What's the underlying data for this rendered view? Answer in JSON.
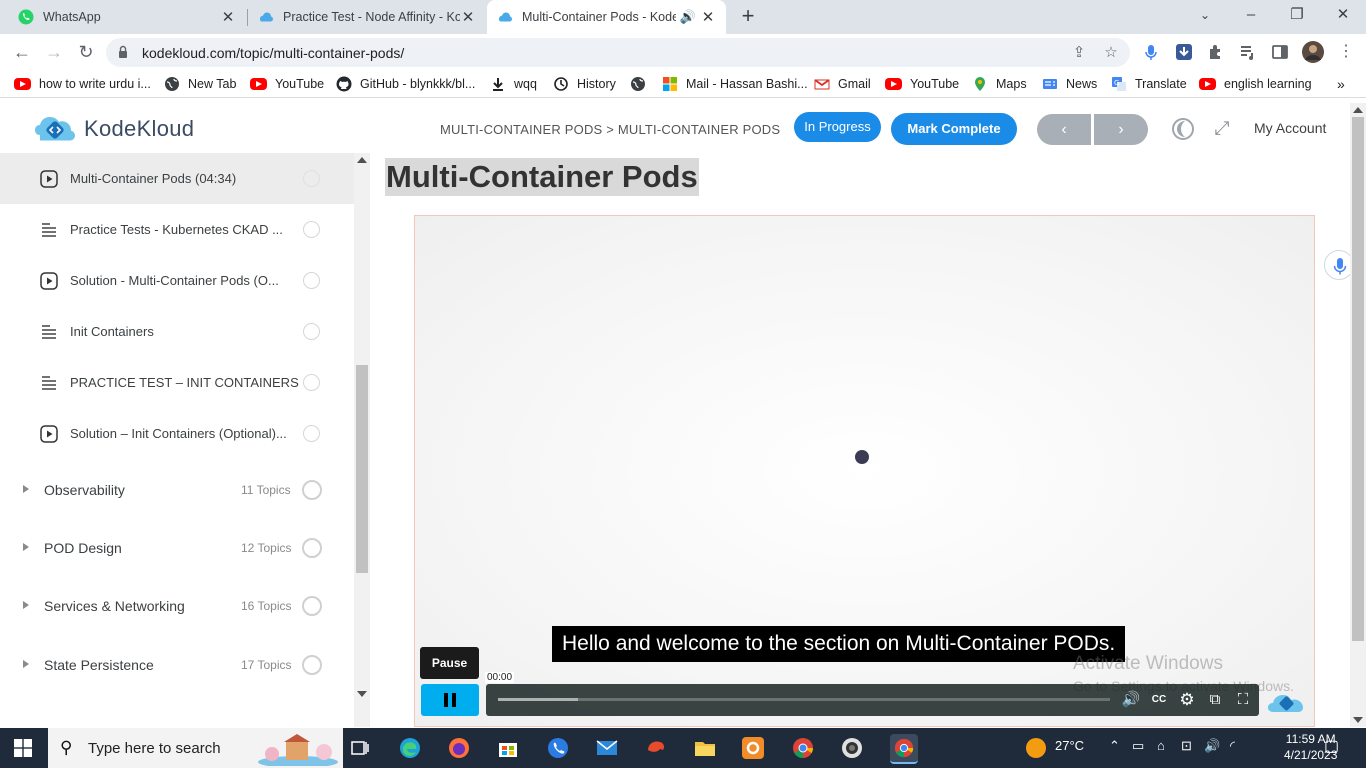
{
  "browser": {
    "tabs": [
      {
        "title": "WhatsApp",
        "active": false
      },
      {
        "title": "Practice Test - Node Affinity - Ko",
        "active": false
      },
      {
        "title": "Multi-Container Pods - Kode",
        "active": true
      }
    ],
    "url": "kodekloud.com/topic/multi-container-pods/",
    "bookmarks": [
      "how to write urdu i...",
      "New Tab",
      "YouTube",
      "GitHub - blynkkk/bl...",
      "wqq",
      "History",
      "Mail - Hassan Bashi...",
      "Gmail",
      "YouTube",
      "Maps",
      "News",
      "Translate",
      "english learning"
    ]
  },
  "header": {
    "brand": "KodeKloud",
    "breadcrumb": "MULTI-CONTAINER PODS > MULTI-CONTAINER PODS",
    "status_label": "In Progress",
    "complete_label": "Mark Complete",
    "prev_label": "‹",
    "next_label": "›",
    "account_label": "My Account"
  },
  "sidebar": {
    "lessons": [
      {
        "title": "Multi-Container Pods (04:34)",
        "type": "video",
        "current": true
      },
      {
        "title": "Practice Tests - Kubernetes CKAD ...",
        "type": "text",
        "current": false
      },
      {
        "title": "Solution - Multi-Container Pods (O...",
        "type": "video",
        "current": false
      },
      {
        "title": "Init Containers",
        "type": "text",
        "current": false
      },
      {
        "title": "PRACTICE TEST – INIT CONTAINERS",
        "type": "text",
        "current": false
      },
      {
        "title": "Solution – Init Containers (Optional)...",
        "type": "video",
        "current": false
      }
    ],
    "sections": [
      {
        "title": "Observability",
        "count": "11 Topics"
      },
      {
        "title": "POD Design",
        "count": "12 Topics"
      },
      {
        "title": "Services & Networking",
        "count": "16 Topics"
      },
      {
        "title": "State Persistence",
        "count": "17 Topics"
      }
    ]
  },
  "main": {
    "title": "Multi-Container Pods",
    "video": {
      "caption": "Hello and welcome to the section on Multi-Container PODs.",
      "pause_tooltip": "Pause",
      "time": "00:00",
      "watermark_line1": "Activate Windows",
      "watermark_line2": "Go to Settings to activate Windows."
    }
  },
  "taskbar": {
    "search_placeholder": "Type here to search",
    "temperature": "27°C",
    "time": "11:59 AM",
    "date": "4/21/2023"
  },
  "colors": {
    "accent": "#1a8ce8",
    "player_accent": "#00adef",
    "chrome_tabstrip": "#dee3ea",
    "taskbar": "#1f2b3a"
  }
}
